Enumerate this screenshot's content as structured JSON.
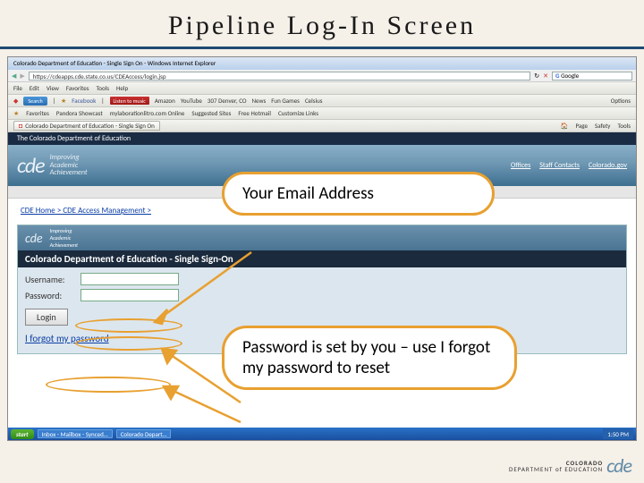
{
  "slide": {
    "title": "Pipeline Log-In Screen"
  },
  "ie": {
    "title": "Colorado Department of Education - Single Sign On - Windows Internet Explorer",
    "url": "https://cdeapps.cde.state.co.us/CDEAccess/login.jsp",
    "gsearch": "Google",
    "menus": [
      "File",
      "Edit",
      "View",
      "Favorites",
      "Tools",
      "Help"
    ],
    "search_btn": "Search",
    "toolbar_items": [
      "Facebook",
      "Listen to music",
      "Amazon",
      "YouTube",
      "307 Denver, CO",
      "News",
      "Fun Games",
      "Celsius",
      "Options"
    ],
    "fav_label": "Favorites",
    "fav_items": [
      "Pandora Showcast",
      "mylaborationlitro.com Online",
      "Suggested Sites",
      "Free Hotmail",
      "Customize Links"
    ],
    "tab": "Colorado Department of Education - Single Sign On",
    "tab_right": [
      "Home",
      "Page",
      "Safety",
      "Tools"
    ]
  },
  "page": {
    "topbar": "The Colorado Department of Education",
    "logo": "cde",
    "tagline": "Improving\nAcademic\nAchievement",
    "links": [
      "Offices",
      "Staff Contacts",
      "Colorado.gov"
    ],
    "breadcrumb": "CDE Home > CDE Access Management >",
    "login_title": "Colorado Department of Education - Single Sign-On",
    "user_label": "Username:",
    "pass_label": "Password:",
    "login_btn": "Login",
    "forgot": "I forgot my password"
  },
  "taskbar": {
    "start": "start",
    "tabs": [
      "Inbox - Mailbox - Synced…",
      "Colorado Depart…"
    ],
    "time": "1:50 PM"
  },
  "callouts": {
    "email": "Your Email Address",
    "password": "Password is set by you – use I forgot my password to reset"
  },
  "footer": {
    "prefix": "COLORADO",
    "dept": "DEPARTMENT of EDUCATION",
    "logo": "cde"
  }
}
